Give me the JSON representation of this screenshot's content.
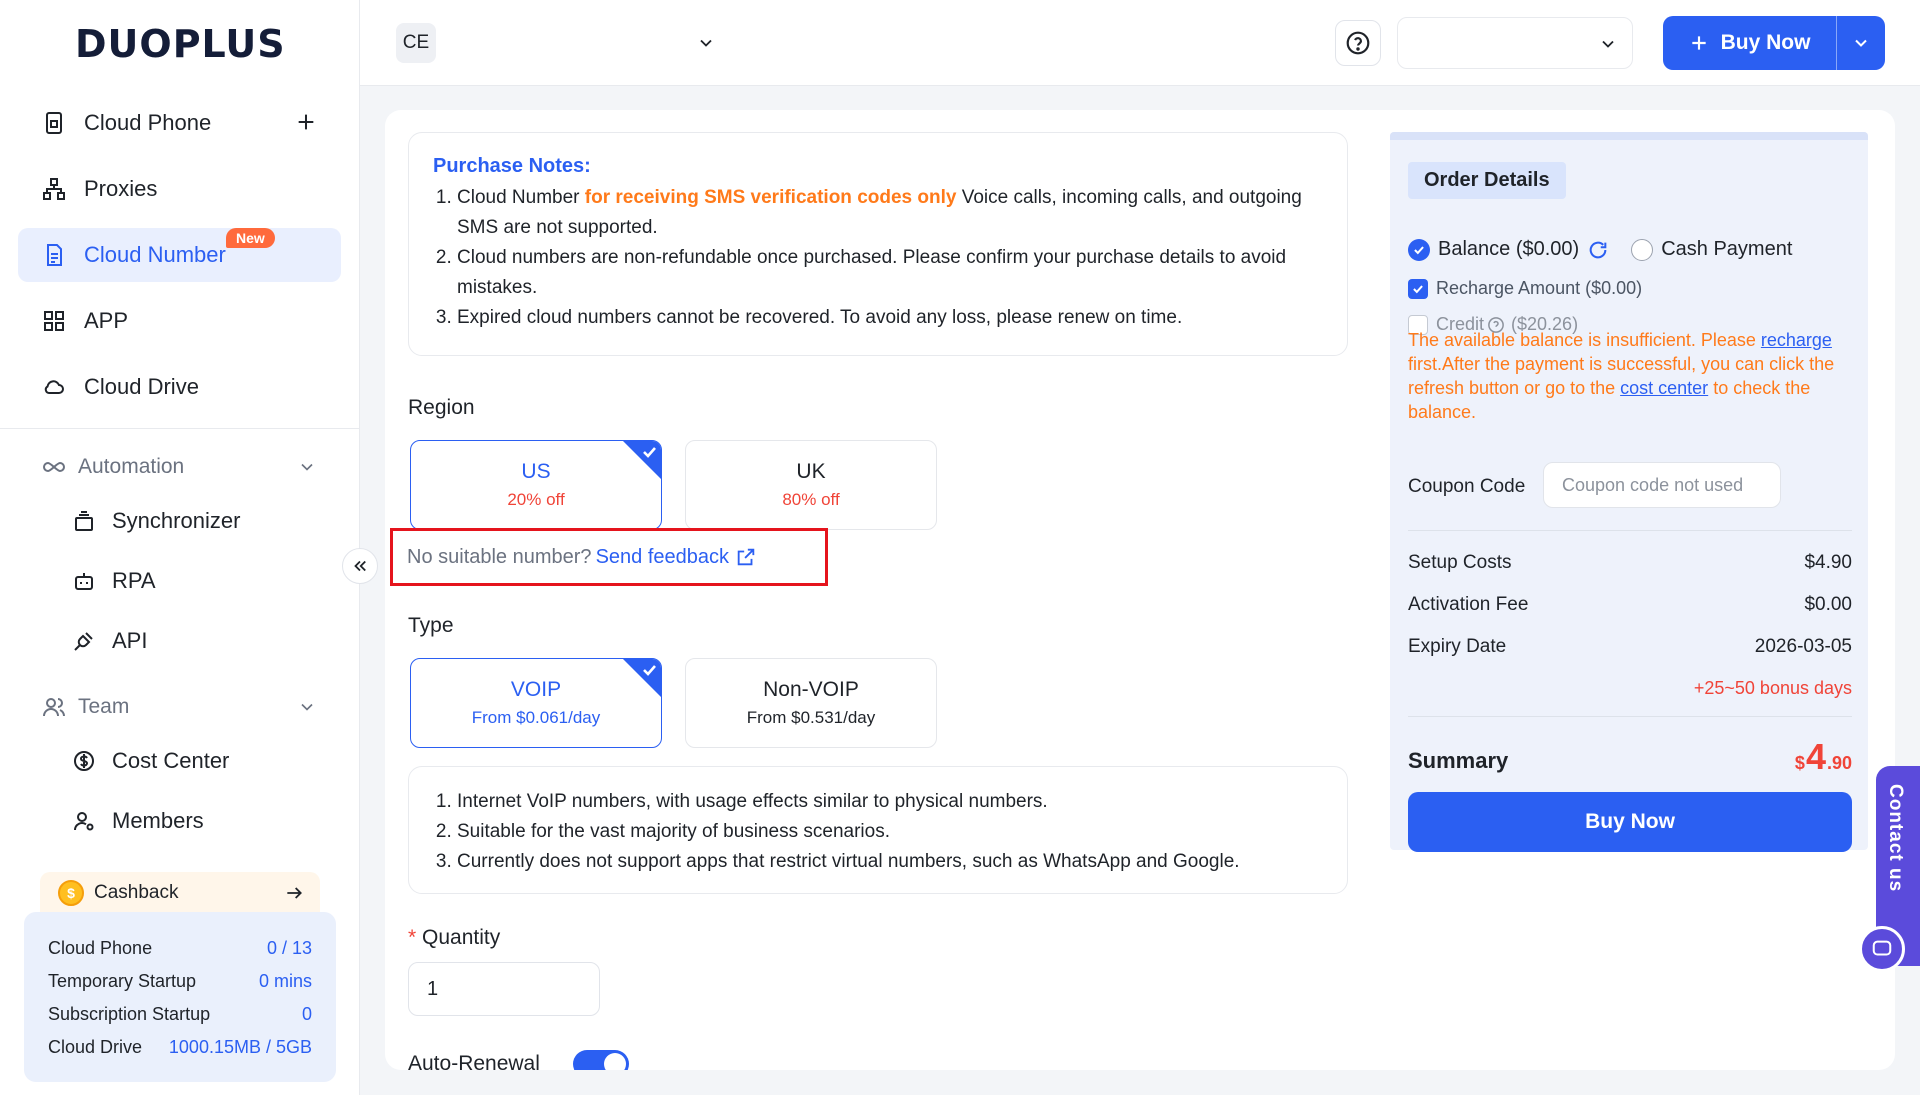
{
  "brand": {
    "logo_text": "DUOPLUS",
    "accent": "#2b5ff2"
  },
  "sidebar": {
    "items": [
      {
        "label": "Cloud Phone",
        "icon": "phone-icon"
      },
      {
        "label": "Proxies",
        "icon": "network-icon"
      },
      {
        "label": "Cloud Number",
        "icon": "sim-icon",
        "badge": "New",
        "active": true
      },
      {
        "label": "APP",
        "icon": "grid-icon"
      },
      {
        "label": "Cloud Drive",
        "icon": "cloud-icon"
      }
    ],
    "automation": {
      "label": "Automation",
      "items": [
        "Synchronizer",
        "RPA",
        "API"
      ]
    },
    "team": {
      "label": "Team",
      "items": [
        "Cost Center",
        "Members"
      ]
    },
    "cashback": "Cashback",
    "usage": [
      {
        "label": "Cloud Phone",
        "value": "0 / 13"
      },
      {
        "label": "Temporary Startup",
        "value": "0 mins"
      },
      {
        "label": "Subscription Startup",
        "value": "0"
      },
      {
        "label": "Cloud Drive",
        "value": "1000.15MB / 5GB"
      }
    ]
  },
  "header": {
    "workspace_initials": "CE",
    "buy_now": "Buy Now"
  },
  "notes": {
    "title": "Purchase Notes:",
    "item1_pre": "Cloud Number ",
    "item1_highlight": "for receiving SMS verification codes only",
    "item1_post": " Voice calls, incoming calls, and outgoing SMS are not supported.",
    "item2": "Cloud numbers are non-refundable once purchased. Please confirm your purchase details to avoid mistakes.",
    "item3": "Expired cloud numbers cannot be recovered. To avoid any loss, please renew on time."
  },
  "region": {
    "label": "Region",
    "options": [
      {
        "name": "US",
        "discount": "20% off",
        "selected": true
      },
      {
        "name": "UK",
        "discount": "80% off",
        "selected": false
      }
    ],
    "feedback_prompt": "No suitable number?",
    "feedback_link": "Send feedback"
  },
  "type": {
    "label": "Type",
    "options": [
      {
        "name": "VOIP",
        "price": "From $0.061/day",
        "selected": true
      },
      {
        "name": "Non-VOIP",
        "price": "From $0.531/day",
        "selected": false
      }
    ],
    "desc": [
      "Internet VoIP numbers, with usage effects similar to physical numbers.",
      "Suitable for the vast majority of business scenarios.",
      "Currently does not support apps that restrict virtual numbers, such as WhatsApp and Google."
    ]
  },
  "quantity": {
    "label": "Quantity",
    "required_mark": "*",
    "value": "1"
  },
  "auto_renewal": {
    "label": "Auto-Renewal",
    "on": true
  },
  "order": {
    "title": "Order Details",
    "balance": "Balance ($0.00)",
    "cash_payment": "Cash Payment",
    "recharge_amount": "Recharge Amount ($0.00)",
    "credit": "Credit",
    "credit_amount": "($20.26)",
    "warn_1": "The available balance is insufficient. Please ",
    "warn_link_1": "recharge",
    "warn_2": " first.After the payment is successful, you can click the refresh button or go to the ",
    "warn_link_2": "cost center",
    "warn_3": " to check the balance.",
    "coupon_label": "Coupon Code",
    "coupon_placeholder": "Coupon code not used",
    "setup_costs_label": "Setup Costs",
    "setup_costs": "$4.90",
    "activation_fee_label": "Activation Fee",
    "activation_fee": "$0.00",
    "expiry_label": "Expiry Date",
    "expiry": "2026-03-05",
    "bonus": "+25~50 bonus days",
    "summary_label": "Summary",
    "summary_currency": "$",
    "summary_int": "4",
    "summary_dec": ".90",
    "buy_now": "Buy Now"
  },
  "contact": {
    "label": "Contact us"
  }
}
